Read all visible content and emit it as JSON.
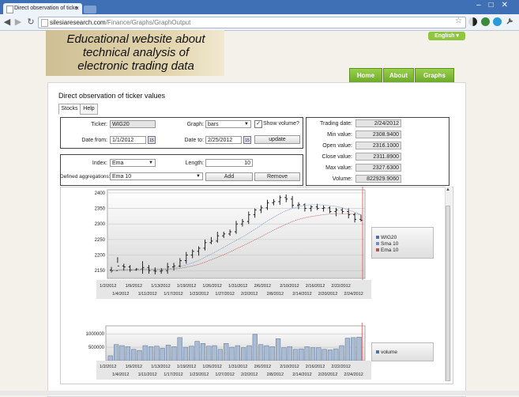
{
  "browser": {
    "tab_title": "Direct observation of ticke",
    "tab_close": "×",
    "window_controls": "–□✕",
    "back": "◀",
    "forward": "▶",
    "reload": "↻",
    "url_host": "silesiaresearch.com",
    "url_path": "/Finance/Graphs/GraphOutput",
    "star": "☆"
  },
  "header": {
    "line1": "Educational website about",
    "line2": "technical analysis of",
    "line3": "electronic trading data"
  },
  "language": "English",
  "nav": [
    {
      "label": "Home"
    },
    {
      "label": "About"
    },
    {
      "label": "Graphs"
    }
  ],
  "page_title": "Direct observation of ticker values",
  "tabs": [
    {
      "label": "Stocks"
    },
    {
      "label": "Help"
    }
  ],
  "form": {
    "ticker_label": "Ticker:",
    "ticker_value": "WIG20",
    "graph_label": "Graph:",
    "graph_value": "bars",
    "show_volume_label": "Show volume?",
    "show_volume_checked": "✓",
    "date_from_label": "Date from:",
    "date_from_value": "1/1/2012",
    "date_to_label": "Date to:",
    "date_to_value": "2/25/2012",
    "calendar_icon": "15",
    "update_label": "update",
    "index_label": "Index:",
    "index_value": "Ema",
    "length_label": "Length:",
    "length_value": "10",
    "aggregations_label": "Defined aggregations:",
    "aggregations_value": "Ema 10",
    "add_label": "Add",
    "remove_label": "Remove"
  },
  "stats": [
    {
      "label": "Trading date:",
      "value": "2/24/2012"
    },
    {
      "label": "Min value:",
      "value": "2308.9400"
    },
    {
      "label": "Open value:",
      "value": "2316.1000"
    },
    {
      "label": "Close value:",
      "value": "2311.8900"
    },
    {
      "label": "Max value:",
      "value": "2327.6300"
    },
    {
      "label": "Volume:",
      "value": "822929.9060"
    }
  ],
  "colors": {
    "accent_green": "#7cb83a",
    "wig20": "#4d6fa3",
    "sma": "#6f8fc7",
    "ema": "#b45555",
    "marker": "#e05050",
    "vol": "#a9bcd4"
  },
  "chart_data": [
    {
      "type": "bar",
      "series": [
        {
          "name": "WIG20"
        },
        {
          "name": "Sma 10"
        },
        {
          "name": "Ema 10"
        }
      ],
      "ylim": [
        2125,
        2410
      ],
      "yticks": [
        2150,
        2200,
        2250,
        2300,
        2350,
        2400
      ],
      "xticks_top": [
        "1/2/2012",
        "1/9/2012",
        "1/13/2012",
        "1/19/2012",
        "1/26/2012",
        "1/31/2012",
        "2/6/2012",
        "2/10/2012",
        "2/16/2012",
        "2/22/2012"
      ],
      "xticks_bottom": [
        "1/4/2012",
        "1/11/2012",
        "1/17/2012",
        "1/23/2012",
        "1/27/2012",
        "2/2/2012",
        "2/8/2012",
        "2/14/2012",
        "2/20/2012",
        "2/24/2012"
      ],
      "ohlc": [
        [
          2152,
          2144,
          2162,
          2150
        ],
        [
          2150,
          2175,
          2193,
          2165
        ],
        [
          2165,
          2150,
          2172,
          2162
        ],
        [
          2162,
          2146,
          2168,
          2152
        ],
        [
          2152,
          2150,
          2158,
          2155
        ],
        [
          2155,
          2140,
          2180,
          2160
        ],
        [
          2160,
          2140,
          2168,
          2150
        ],
        [
          2150,
          2138,
          2160,
          2148
        ],
        [
          2148,
          2140,
          2158,
          2150
        ],
        [
          2150,
          2140,
          2175,
          2162
        ],
        [
          2162,
          2150,
          2175,
          2165
        ],
        [
          2165,
          2160,
          2190,
          2182
        ],
        [
          2182,
          2172,
          2210,
          2200
        ],
        [
          2200,
          2190,
          2218,
          2212
        ],
        [
          2212,
          2198,
          2228,
          2222
        ],
        [
          2222,
          2215,
          2250,
          2240
        ],
        [
          2240,
          2235,
          2258,
          2245
        ],
        [
          2245,
          2240,
          2275,
          2262
        ],
        [
          2262,
          2255,
          2275,
          2268
        ],
        [
          2268,
          2262,
          2282,
          2275
        ],
        [
          2275,
          2268,
          2310,
          2300
        ],
        [
          2300,
          2292,
          2316,
          2308
        ],
        [
          2308,
          2300,
          2340,
          2330
        ],
        [
          2330,
          2320,
          2350,
          2345
        ],
        [
          2345,
          2335,
          2360,
          2352
        ],
        [
          2352,
          2345,
          2378,
          2368
        ],
        [
          2368,
          2360,
          2380,
          2372
        ],
        [
          2372,
          2362,
          2392,
          2385
        ],
        [
          2385,
          2370,
          2395,
          2380
        ],
        [
          2380,
          2352,
          2390,
          2360
        ],
        [
          2360,
          2348,
          2370,
          2362
        ],
        [
          2362,
          2340,
          2366,
          2350
        ],
        [
          2350,
          2340,
          2360,
          2355
        ],
        [
          2355,
          2345,
          2365,
          2350
        ],
        [
          2350,
          2340,
          2360,
          2352
        ],
        [
          2352,
          2335,
          2356,
          2340
        ],
        [
          2340,
          2325,
          2352,
          2345
        ],
        [
          2345,
          2332,
          2352,
          2340
        ],
        [
          2340,
          2318,
          2350,
          2330
        ],
        [
          2330,
          2305,
          2336,
          2315
        ],
        [
          2315,
          2308,
          2330,
          2312
        ]
      ],
      "sma": [
        2152,
        2152,
        2154,
        2154,
        2154,
        2155,
        2155,
        2155,
        2155,
        2156,
        2158,
        2163,
        2168,
        2175,
        2183,
        2193,
        2203,
        2214,
        2225,
        2236,
        2247,
        2258,
        2270,
        2283,
        2296,
        2310,
        2322,
        2333,
        2343,
        2350,
        2356,
        2360,
        2362,
        2362,
        2361,
        2359,
        2357,
        2352,
        2345,
        2338,
        2330
      ],
      "ema": [
        2150,
        2151,
        2151,
        2152,
        2152,
        2153,
        2153,
        2153,
        2153,
        2154,
        2155,
        2157,
        2161,
        2165,
        2170,
        2177,
        2185,
        2193,
        2201,
        2210,
        2220,
        2229,
        2239,
        2249,
        2259,
        2270,
        2280,
        2290,
        2299,
        2308,
        2315,
        2320,
        2324,
        2327,
        2330,
        2332,
        2333,
        2333,
        2333,
        2332,
        2330
      ],
      "marker_index": 40
    },
    {
      "type": "bar",
      "series": [
        {
          "name": "volume"
        }
      ],
      "ylim": [
        0,
        1300000
      ],
      "yticks": [
        500000,
        1000000
      ],
      "values": [
        180000,
        600000,
        560000,
        520000,
        420000,
        380000,
        560000,
        520000,
        540000,
        460000,
        580000,
        520000,
        860000,
        500000,
        540000,
        720000,
        640000,
        540000,
        560000,
        420000,
        640000,
        500000,
        560000,
        480000,
        560000,
        980000,
        600000,
        560000,
        520000,
        820000,
        480000,
        520000,
        420000,
        440000,
        520000,
        480000,
        480000,
        420000,
        400000,
        440000,
        560000,
        840000,
        860000,
        880000
      ],
      "marker_index": 43
    }
  ]
}
